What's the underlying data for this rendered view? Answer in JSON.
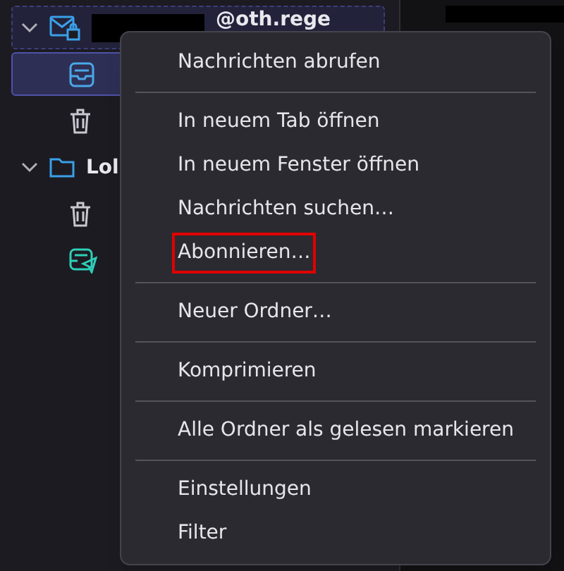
{
  "sidebar": {
    "items": [
      {
        "kind": "mail_account",
        "label": "@oth.rege",
        "expanded": true,
        "selected": false
      },
      {
        "kind": "inbox",
        "selected": true
      },
      {
        "kind": "trash",
        "selected": false
      },
      {
        "kind": "local_account",
        "label": "Lol",
        "expanded": true,
        "selected": false
      },
      {
        "kind": "trash",
        "selected": false
      },
      {
        "kind": "outbox",
        "selected": false
      }
    ]
  },
  "context_menu": {
    "items": [
      {
        "kind": "item",
        "label": "Nachrichten abrufen",
        "highlighted": false
      },
      {
        "kind": "separator"
      },
      {
        "kind": "item",
        "label": "In neuem Tab öffnen",
        "highlighted": false
      },
      {
        "kind": "item",
        "label": "In neuem Fenster öffnen",
        "highlighted": false
      },
      {
        "kind": "item",
        "label": "Nachrichten suchen…",
        "highlighted": false
      },
      {
        "kind": "item",
        "label": "Abonnieren…",
        "highlighted": true
      },
      {
        "kind": "separator"
      },
      {
        "kind": "item",
        "label": "Neuer Ordner…",
        "highlighted": false
      },
      {
        "kind": "separator"
      },
      {
        "kind": "item",
        "label": "Komprimieren",
        "highlighted": false
      },
      {
        "kind": "separator"
      },
      {
        "kind": "item",
        "label": "Alle Ordner als gelesen markieren",
        "highlighted": false
      },
      {
        "kind": "separator"
      },
      {
        "kind": "item",
        "label": "Einstellungen",
        "highlighted": false
      },
      {
        "kind": "item",
        "label": "Filter",
        "highlighted": false
      }
    ]
  }
}
